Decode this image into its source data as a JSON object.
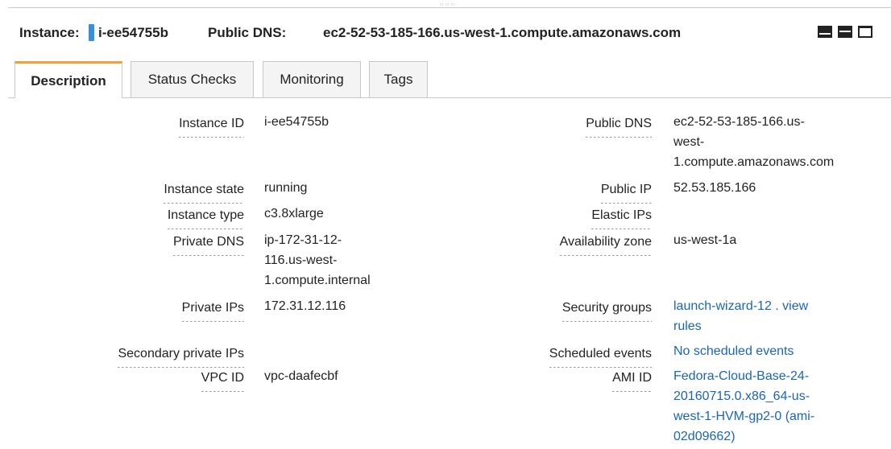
{
  "header": {
    "instance_label": "Instance:",
    "instance_id": "i-ee54755b",
    "dns_label": "Public DNS:",
    "dns_value": "ec2-52-53-185-166.us-west-1.compute.amazonaws.com",
    "drag_handle": "○○○"
  },
  "tabs": [
    {
      "label": "Description",
      "active": true
    },
    {
      "label": "Status Checks",
      "active": false
    },
    {
      "label": "Monitoring",
      "active": false
    },
    {
      "label": "Tags",
      "active": false
    }
  ],
  "left_fields": [
    {
      "label": "Instance ID",
      "value_lines": [
        "i-ee54755b"
      ]
    },
    {
      "label": "Instance state",
      "value_lines": [
        "running"
      ]
    },
    {
      "label": "Instance type",
      "value_lines": [
        "c3.8xlarge"
      ]
    },
    {
      "label": "Private DNS",
      "value_lines": [
        "ip-172-31-12-",
        "116.us-west-",
        "1.compute.internal"
      ]
    },
    {
      "label": "Private IPs",
      "value_lines": [
        "172.31.12.116"
      ]
    },
    {
      "label": "Secondary private IPs",
      "value_lines": []
    },
    {
      "label": "VPC ID",
      "value_lines": [
        "vpc-daafecbf"
      ]
    }
  ],
  "right_fields": [
    {
      "label": "Public DNS",
      "value_lines": [
        "ec2-52-53-185-166.us-",
        "west-",
        "1.compute.amazonaws.com"
      ]
    },
    {
      "label": "Public IP",
      "value_lines": [
        "52.53.185.166"
      ]
    },
    {
      "label": "Elastic IPs",
      "value_lines": []
    },
    {
      "label": "Availability zone",
      "value_lines": [
        "us-west-1a"
      ]
    },
    {
      "label": "Security groups",
      "value_lines": [
        "launch-wizard-12 . view",
        "rules"
      ],
      "link": true
    },
    {
      "label": "Scheduled events",
      "value_lines": [
        "No scheduled events"
      ],
      "link": true
    },
    {
      "label": "AMI ID",
      "value_lines": [
        "Fedora-Cloud-Base-24-",
        "20160715.0.x86_64-us-",
        "west-1-HVM-gp2-0 (ami-",
        "02d09662)"
      ],
      "link": true
    }
  ],
  "colors": {
    "id_marker": "#3a8fd9",
    "active_tab_accent": "#f0a23a",
    "link": "#1a66b5"
  },
  "icons": [
    "layout-bottom-icon",
    "layout-middle-icon",
    "layout-top-icon"
  ]
}
